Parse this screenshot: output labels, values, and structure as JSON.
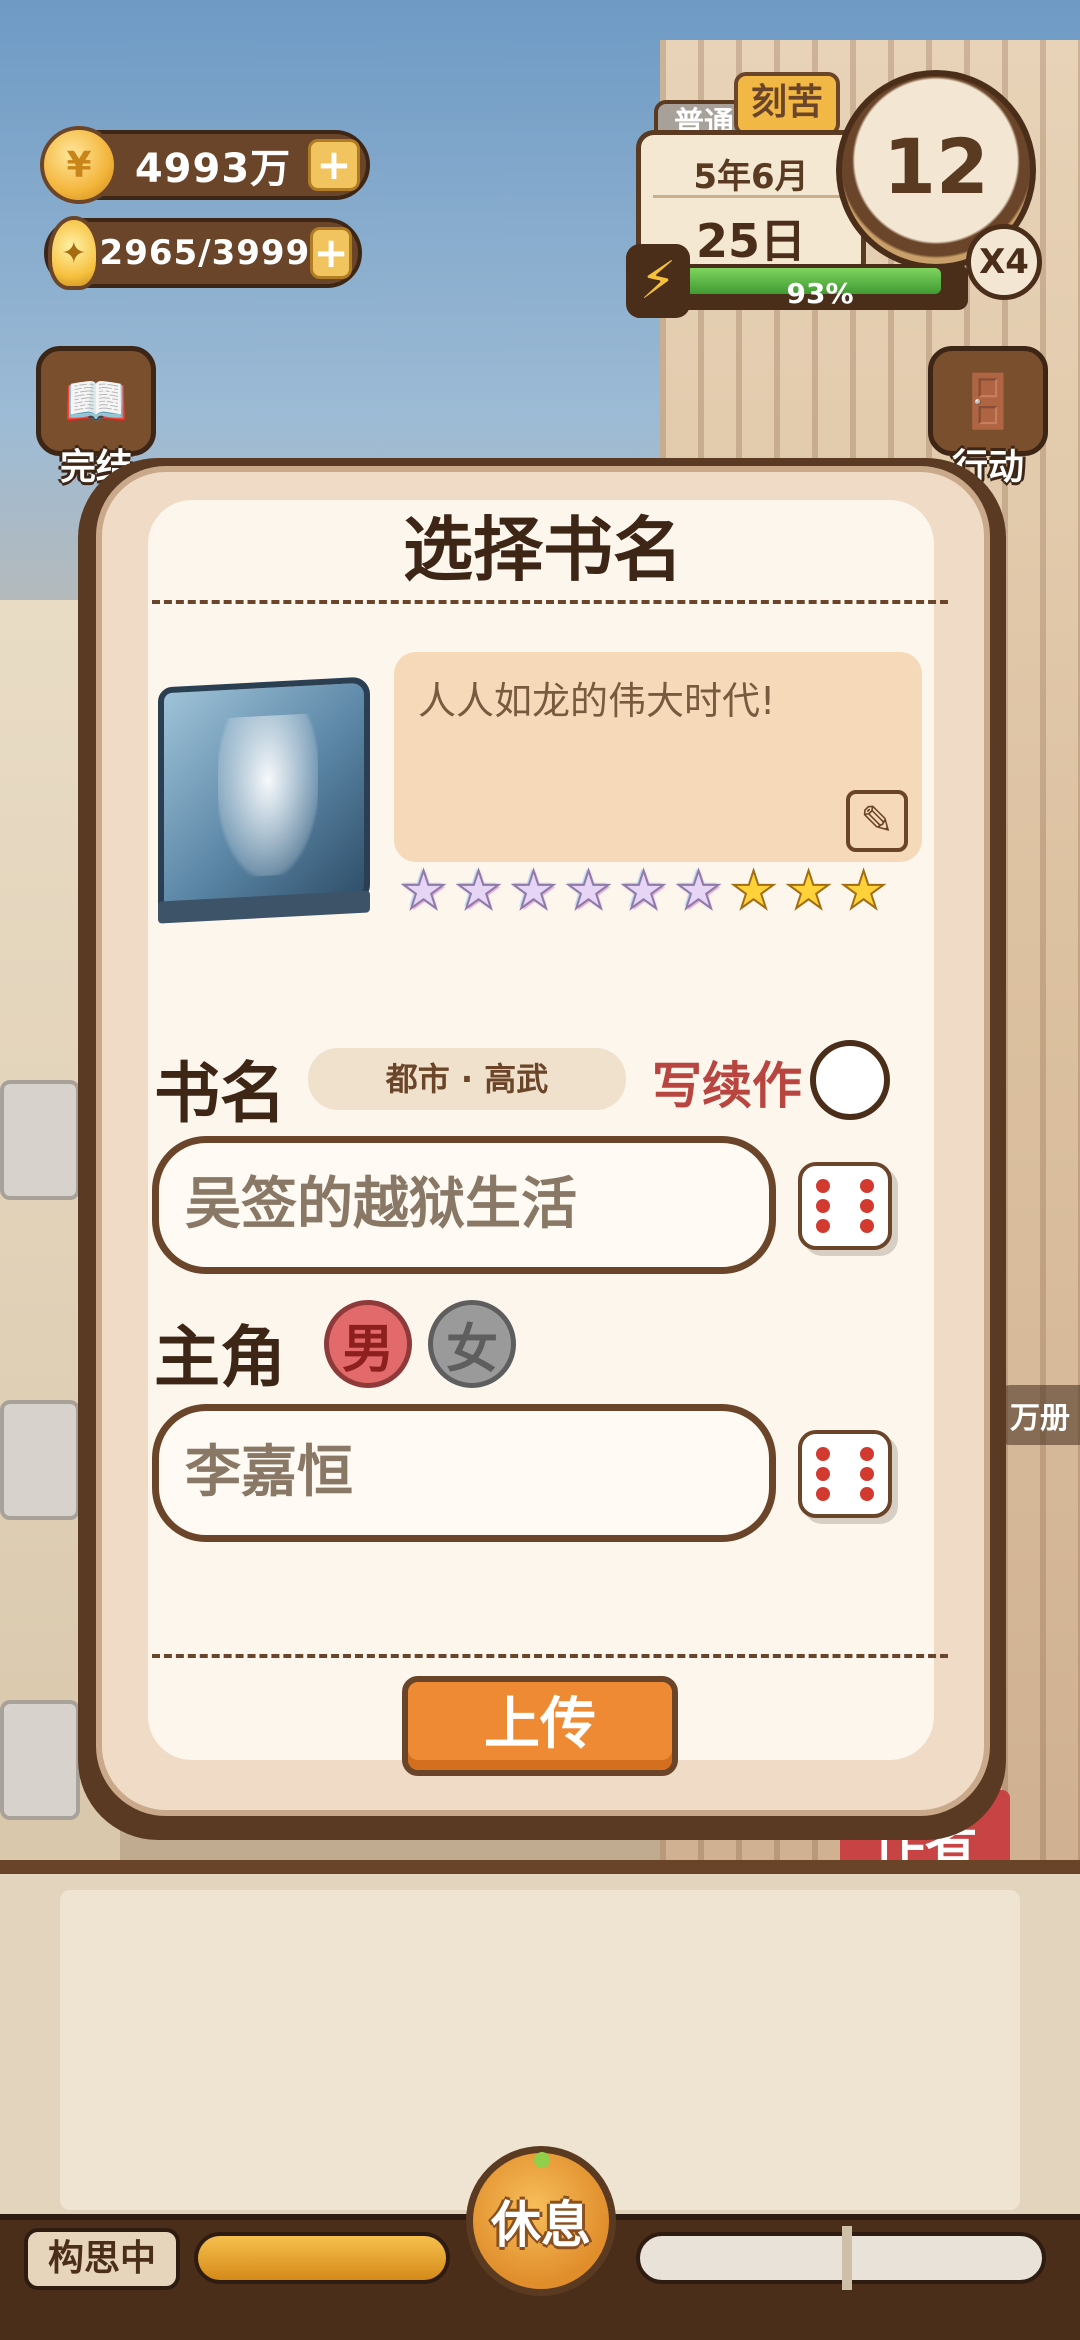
{
  "hud": {
    "money": "4993万",
    "inspiration": "2965/3999",
    "plus_symbol": "+",
    "mode": "普通",
    "effort": "刻苦",
    "month": "5年6月",
    "day": "25日",
    "clock_hour": "12",
    "speed": "X4",
    "energy_percent": "93%",
    "energy_value": 0.93
  },
  "side_buttons": {
    "left": [
      {
        "label": "完结",
        "icon": "book-open-icon"
      }
    ],
    "right": [
      {
        "label": "行动",
        "icon": "door-arrow-icon"
      }
    ]
  },
  "modal": {
    "title": "选择书名",
    "description": "人人如龙的伟大时代!",
    "rating": {
      "rainbow": 6,
      "gold": 3
    },
    "book_name_label": "书名",
    "genre": "都市 · 高武",
    "sequel_label": "写续作",
    "book_name_value": "吴签的越狱生活",
    "protagonist_label": "主角",
    "gender_male": "男",
    "gender_female": "女",
    "selected_gender": "男",
    "protagonist_value": "李嘉恒",
    "upload_label": "上传"
  },
  "background": {
    "sign_text": "作者",
    "side_tag": "万册"
  },
  "bottom": {
    "status": "构思中",
    "rest_label": "休息",
    "progress_left": 1.0
  },
  "colors": {
    "accent_orange": "#ee8a33",
    "wood_brown": "#6b4529",
    "sequel_red": "#b8453f",
    "energy_green": "#3f9a32"
  }
}
